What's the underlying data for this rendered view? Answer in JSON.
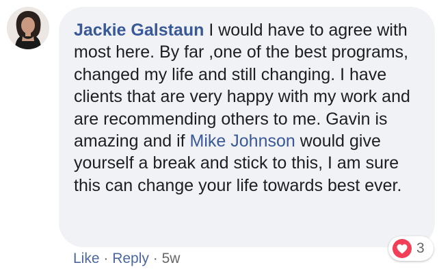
{
  "comment": {
    "author": "Jackie Galstaun",
    "text_before_mention": " I would have to agree with most here. By far ,one of the best programs, changed my life and still changing. I have clients that are very happy with my work and are recommending others to me. Gavin is amazing and if ",
    "mention": "Mike Johnson",
    "text_after_mention": " would give yourself a break and stick to this, I am sure this can change your life towards best ever."
  },
  "reactions": {
    "icon": "heart-icon",
    "count": "3",
    "color": "#f33e58"
  },
  "actions": {
    "like_label": "Like",
    "separator": " · ",
    "reply_label": "Reply",
    "time": "5w"
  },
  "colors": {
    "link": "#385898",
    "bubble": "#f0f2f5",
    "text": "#1c1e21"
  }
}
